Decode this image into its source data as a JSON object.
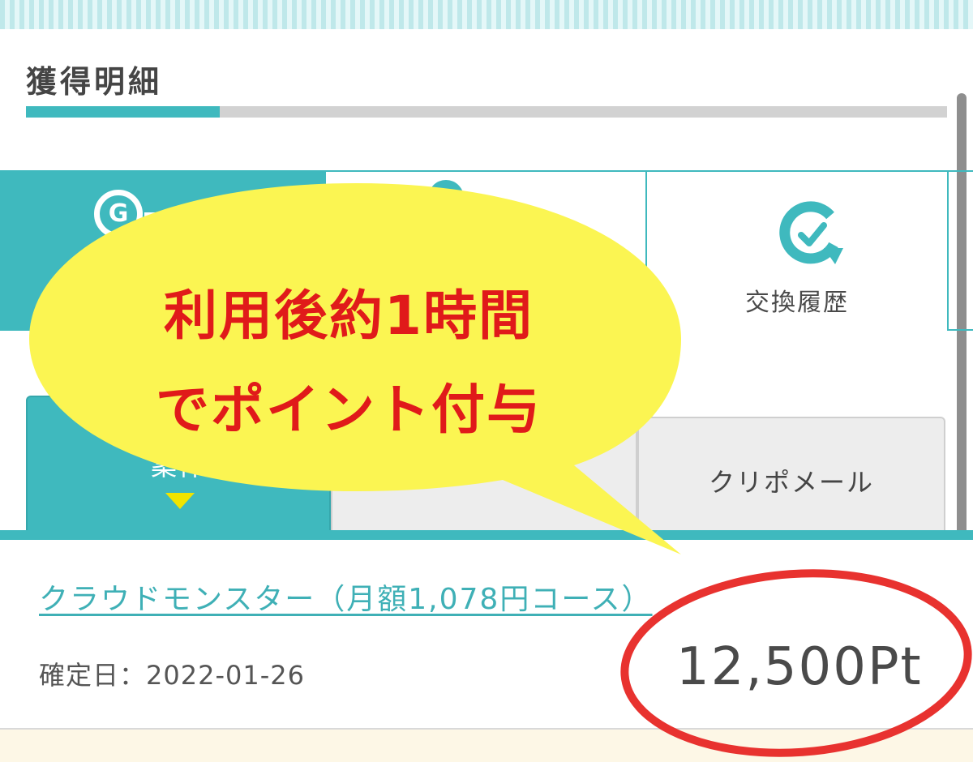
{
  "header": {
    "title": "獲得明細",
    "progress_percent": 21
  },
  "main_tabs": [
    {
      "label": "",
      "icon": "g-point-icon",
      "selected": true
    },
    {
      "label": "",
      "icon": "circle-icon",
      "selected": false
    },
    {
      "label": "交換履歴",
      "icon": "history-check-icon",
      "selected": false
    }
  ],
  "sub_tabs": [
    {
      "label": "案件",
      "selected": true
    },
    {
      "label": "",
      "selected": false
    },
    {
      "label": "クリポメール",
      "selected": false
    }
  ],
  "items": [
    {
      "title": "クラウドモンスター（月額1,078円コース）",
      "confirmed_date": "確定日：2022-01-26",
      "points": "12,500Pt"
    }
  ],
  "annotation": {
    "line1": "利用後約1時間",
    "line2": "でポイント付与",
    "bubble_color": "#fbf552",
    "text_color": "#e01a1a",
    "circle_color": "#e8322f"
  },
  "colors": {
    "accent": "#3fb9be",
    "link": "#3fb0b6"
  }
}
